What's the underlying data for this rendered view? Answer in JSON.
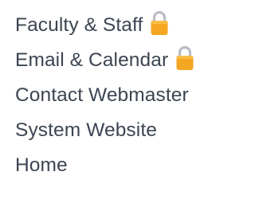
{
  "nav": {
    "items": [
      {
        "label": "Faculty & Staff",
        "icon": "lock-icon",
        "locked": true
      },
      {
        "label": "Email & Calendar",
        "icon": "lock-icon",
        "locked": true
      },
      {
        "label": "Contact Webmaster",
        "locked": false
      },
      {
        "label": "System Website",
        "locked": false
      },
      {
        "label": "Home",
        "locked": false
      }
    ],
    "text_color": "#3c4552",
    "lock_body_color": "#f5a623",
    "lock_shackle_color": "#b9bec4"
  }
}
